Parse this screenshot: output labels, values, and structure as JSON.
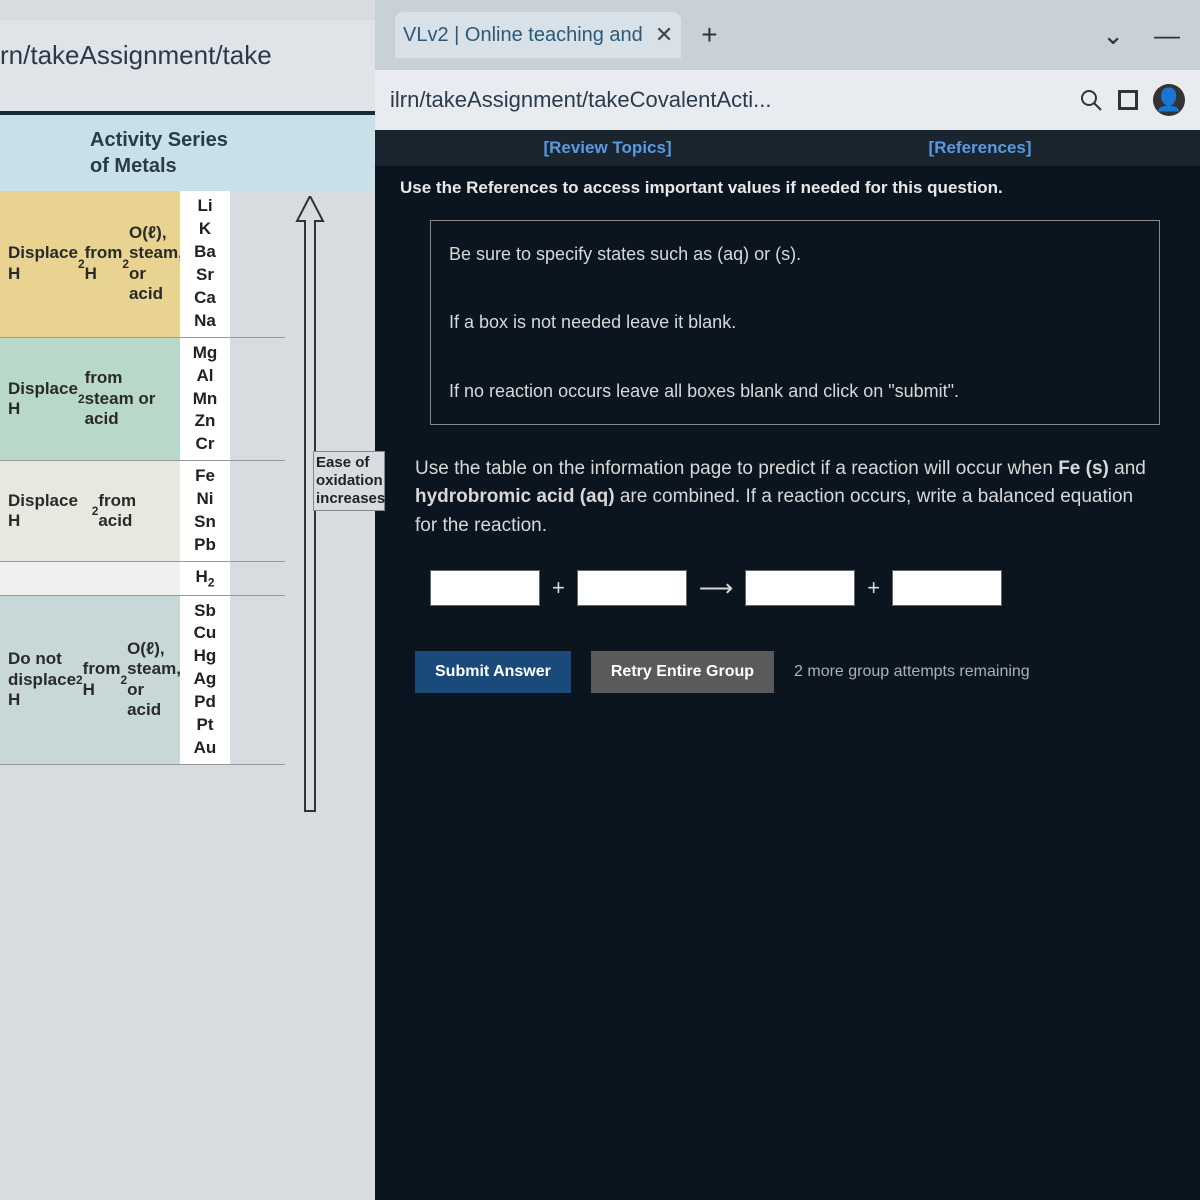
{
  "left": {
    "url_fragment": "rn/takeAssignment/take",
    "title_line1": "Activity Series",
    "title_line2": "of Metals",
    "groups": {
      "g1": {
        "label": "Displace H₂ from H₂O(ℓ), steam, or acid",
        "metals": [
          "Li",
          "K",
          "Ba",
          "Sr",
          "Ca",
          "Na"
        ]
      },
      "g2": {
        "label": "Displace H₂ from steam or acid",
        "metals": [
          "Mg",
          "Al",
          "Mn",
          "Zn",
          "Cr"
        ]
      },
      "g3": {
        "label": "Displace H₂ from acid",
        "metals": [
          "Fe",
          "Ni",
          "Sn",
          "Pb"
        ]
      },
      "g4": {
        "label": "",
        "metals": [
          "H₂"
        ]
      },
      "g5": {
        "label": "Do not displace H₂ from H₂O(ℓ), steam, or acid",
        "metals": [
          "Sb",
          "Cu",
          "Hg",
          "Ag",
          "Pd",
          "Pt",
          "Au"
        ]
      }
    },
    "arrow_label": "Ease of oxidation increases"
  },
  "right": {
    "tab_title": "VLv2 | Online teaching and",
    "url": "ilrn/takeAssignment/takeCovalentActi...",
    "links": {
      "review": "[Review Topics]",
      "references": "[References]"
    },
    "instruction": "Use the References to access important values if needed for this question.",
    "hint1": "Be sure to specify states such as (aq) or (s).",
    "hint2": "If a box is not needed leave it blank.",
    "hint3": "If no reaction occurs leave all boxes blank and click on \"submit\".",
    "question_pre": "Use the table on the information page to predict if a reaction will occur when ",
    "question_b1": "Fe (s)",
    "question_mid": " and ",
    "question_b2": "hydrobromic acid (aq)",
    "question_post": " are combined. If a reaction occurs, write a balanced equation for the reaction.",
    "plus": "+",
    "arrow": "⟶",
    "submit": "Submit Answer",
    "retry": "Retry Entire Group",
    "attempts": "2 more group attempts remaining"
  }
}
